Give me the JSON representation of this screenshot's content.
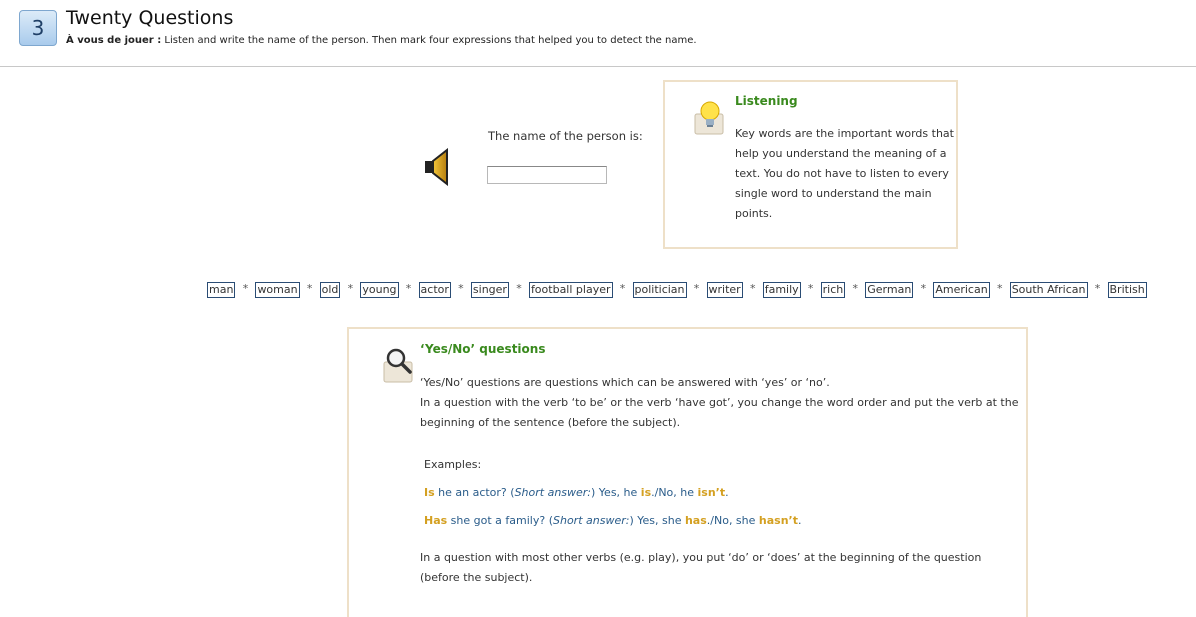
{
  "header": {
    "number": "3",
    "title": "Twenty Questions",
    "instruction_bold": "À vous de jouer :",
    "instruction_text": " Listen and write the name of the person. Then mark four expressions that helped you to detect the name."
  },
  "answer": {
    "label": "The name of the person is:",
    "value": ""
  },
  "tip": {
    "title": "Listening",
    "text": "Key words are the important words that help you understand the meaning of a text. You do not have to listen to every single word to understand the main points."
  },
  "words": [
    "man",
    "woman",
    "old",
    "young",
    "actor",
    "singer",
    "football player",
    "politician",
    "writer",
    "family",
    "rich",
    "German",
    "American",
    "South African",
    "British"
  ],
  "separator": "*",
  "grammar": {
    "title": "‘Yes/No’ questions",
    "para1_line1": "‘Yes/No’ questions are questions which can be answered with ‘yes’ or ‘no’.",
    "para1_line2": "In a question with the verb ‘to be’ or the verb ‘have got’, you change the word order and put the verb at the beginning of the sentence (before the subject).",
    "examples_label": "Examples:",
    "ex1": {
      "verb": "Is",
      "rest": " he an actor?  (",
      "short": "Short answer:",
      "after": ") Yes, he ",
      "a1": "is",
      "mid": "./No, he ",
      "a2": "isn’t",
      "end": "."
    },
    "ex2": {
      "verb": "Has",
      "rest": " she got a family?  (",
      "short": "Short answer:",
      "after": ") Yes, she ",
      "a1": "has",
      "mid": "./No, she ",
      "a2": "hasn’t",
      "end": "."
    },
    "para2": "In a question with most other verbs (e.g. play), you put ‘do’ or ‘does’ at the beginning of the question (before the subject)."
  },
  "colors": {
    "accent_green": "#3a8a1e",
    "highlight": "#d4a021",
    "box_border": "#eee0c8"
  }
}
